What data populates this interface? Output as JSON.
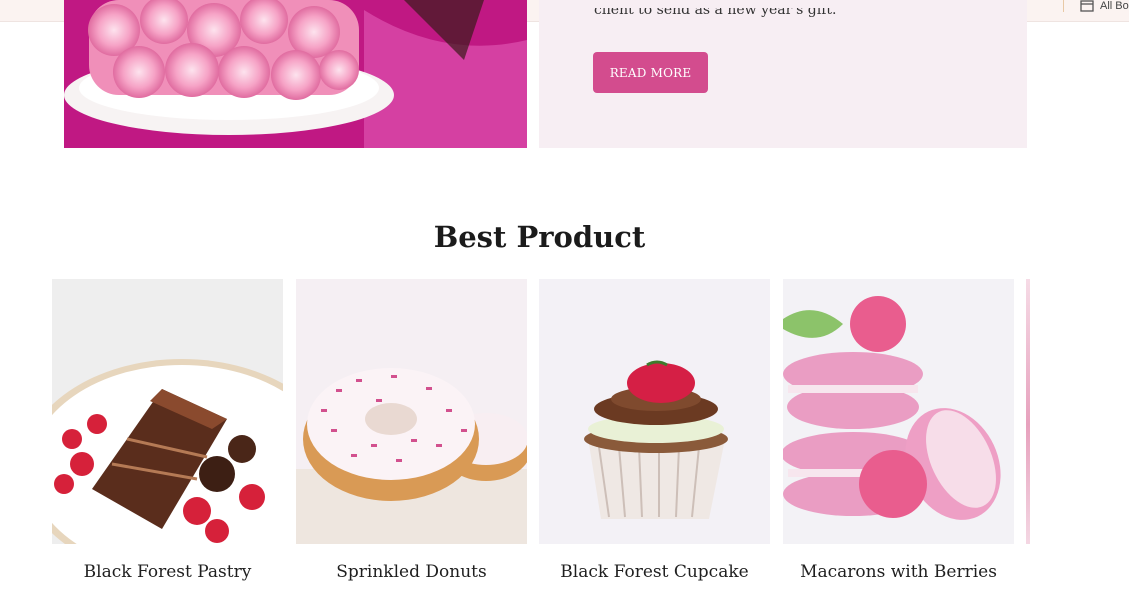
{
  "topbar": {
    "all_button_label": "All Bo"
  },
  "feature": {
    "excerpt": "client to send as a new year's gift.",
    "read_more_label": "READ MORE"
  },
  "best_product": {
    "title": "Best Product",
    "products": [
      {
        "name": "Black Forest Pastry"
      },
      {
        "name": "Sprinkled Donuts"
      },
      {
        "name": "Black Forest Cupcake"
      },
      {
        "name": "Macarons with Berries"
      }
    ]
  },
  "colors": {
    "accent": "#d34c8e",
    "panel_bg": "#f7eef3",
    "topbar_bg": "#fbf3f1"
  }
}
